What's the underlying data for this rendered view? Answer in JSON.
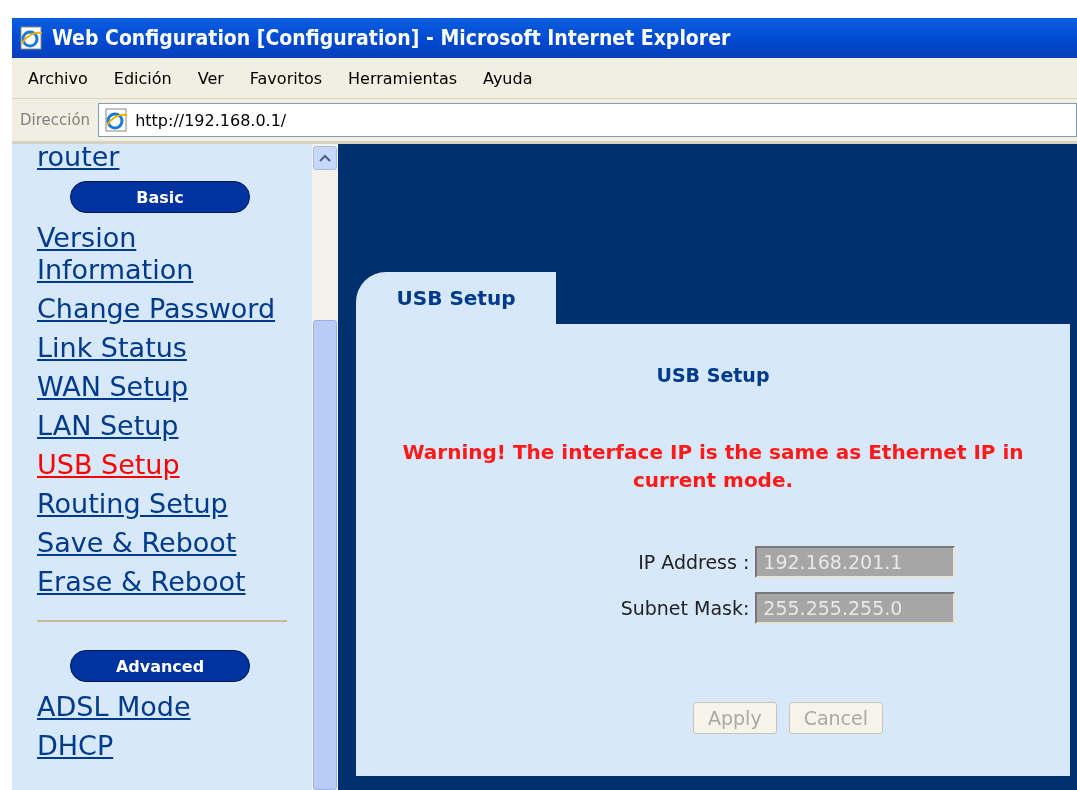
{
  "window": {
    "title": "Web Configuration [Configuration] - Microsoft Internet Explorer"
  },
  "menu": [
    {
      "label": "Archivo"
    },
    {
      "label": "Edición"
    },
    {
      "label": "Ver"
    },
    {
      "label": "Favoritos"
    },
    {
      "label": "Herramientas"
    },
    {
      "label": "Ayuda"
    }
  ],
  "address_bar": {
    "label": "Dirección",
    "value": "http://192.168.0.1/"
  },
  "sidebar": {
    "items": [
      {
        "kind": "link",
        "label": "router",
        "selected": false
      },
      {
        "kind": "header",
        "label": "Basic"
      },
      {
        "kind": "link",
        "label": "Version Information",
        "selected": false
      },
      {
        "kind": "link",
        "label": "Change Password",
        "selected": false
      },
      {
        "kind": "link",
        "label": "Link Status",
        "selected": false
      },
      {
        "kind": "link",
        "label": "WAN Setup",
        "selected": false
      },
      {
        "kind": "link",
        "label": "LAN Setup",
        "selected": false
      },
      {
        "kind": "link",
        "label": "USB Setup",
        "selected": true
      },
      {
        "kind": "link",
        "label": "Routing Setup",
        "selected": false
      },
      {
        "kind": "link",
        "label": "Save & Reboot",
        "selected": false
      },
      {
        "kind": "link",
        "label": "Erase & Reboot",
        "selected": false
      },
      {
        "kind": "divider"
      },
      {
        "kind": "header",
        "label": "Advanced"
      },
      {
        "kind": "link",
        "label": "ADSL Mode",
        "selected": false
      },
      {
        "kind": "link",
        "label": "DHCP",
        "selected": false
      }
    ]
  },
  "panel": {
    "tab": "USB Setup",
    "title": "USB Setup",
    "warning": "Warning! The interface IP is the same as Ethernet IP in current mode.",
    "fields": [
      {
        "label": "IP Address :",
        "value": "192.168.201.1",
        "disabled": true
      },
      {
        "label": "Subnet Mask:",
        "value": "255.255.255.0",
        "disabled": true
      }
    ],
    "buttons": [
      {
        "label": "Apply",
        "disabled": true
      },
      {
        "label": "Cancel",
        "disabled": true
      }
    ]
  }
}
